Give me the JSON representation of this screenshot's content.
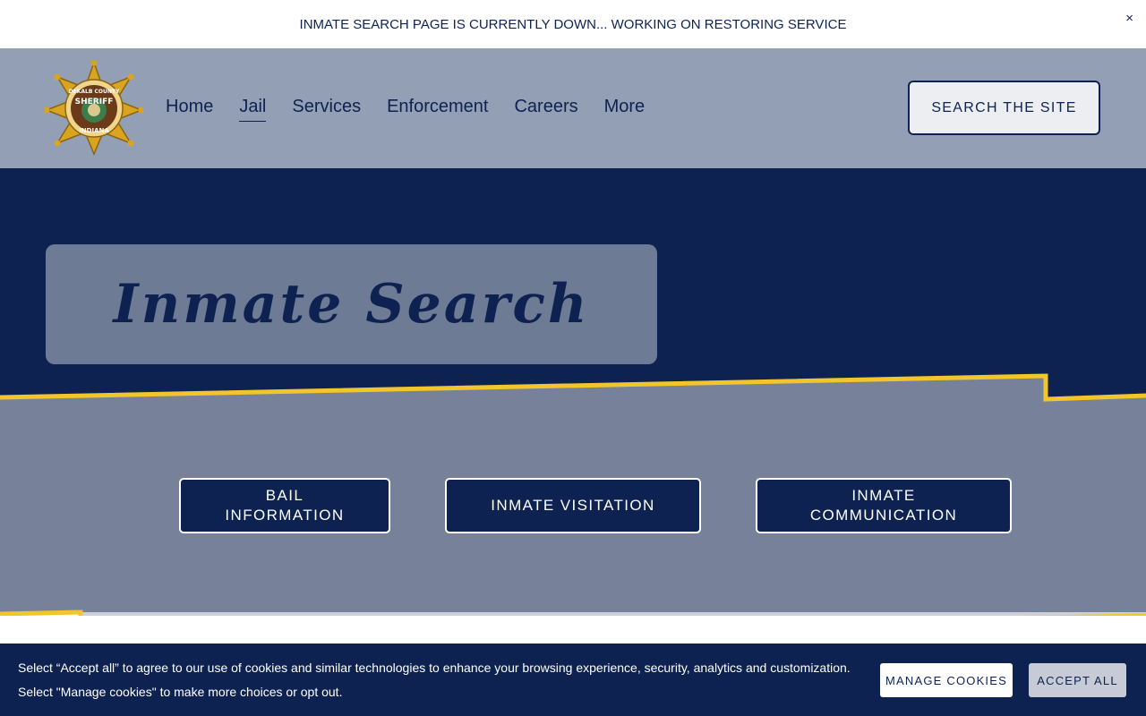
{
  "announcement": {
    "text": "INMATE SEARCH PAGE IS CURRENTLY DOWN...  WORKING ON RESTORING SERVICE",
    "close": "×"
  },
  "header": {
    "logo_text": [
      "DEKALB COUNTY",
      "SHERIFF",
      "INDIANA"
    ],
    "nav": [
      "Home",
      "Jail",
      "Services",
      "Enforcement",
      "Careers",
      "More"
    ],
    "active_nav": "Jail",
    "search_label": "SEARCH THE SITE"
  },
  "hero": {
    "title": "Inmate Search"
  },
  "buttons": {
    "bail": "BAIL INFORMATION",
    "visitation": "INMATE VISITATION",
    "communication": "INMATE COMMUNICATION"
  },
  "cookie": {
    "text": "Select “Accept all” to agree to our use of cookies and similar technologies to enhance your browsing experience, security, analytics and customization. Select \"Manage cookies\" to make more choices or opt out.",
    "manage": "MANAGE COOKIES",
    "accept": "ACCEPT ALL"
  },
  "colors": {
    "navy": "#0e2252",
    "header_bg": "#939fb5",
    "band": "#77819a",
    "gold": "#f2c52b"
  }
}
